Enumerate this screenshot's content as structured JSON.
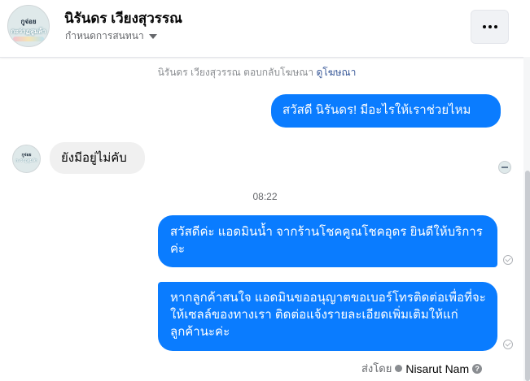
{
  "header": {
    "name": "นิรันดร เวียงสุวรรณ",
    "subtitle": "กำหนดการสนทนา",
    "avatar_text_line1": "กูจ่อย",
    "avatar_text_line2": "กะว่าฏสูมล้า"
  },
  "context": {
    "text": "นิรันดร เวียงสุวรรณ ตอบกลับโฆษณา",
    "link": "ดูโฆษณา"
  },
  "messages": [
    {
      "direction": "outgoing",
      "text": "สวัสดี นิรันดร! มีอะไรให้เราช่วยไหม"
    },
    {
      "direction": "incoming",
      "text": "ยังมีอยู่ไม่คับ"
    },
    {
      "direction": "outgoing",
      "text": "สวัสดีค่ะ แอดมินน้ำ จากร้านโชคคูณโชคอุดร ยินดีให้บริการค่ะ"
    },
    {
      "direction": "outgoing",
      "text": "หากลูกค้าสนใจ แอดมินขออนุญาตขอเบอร์โทรติดต่อเพื่อที่จะให้เซลล์ของทางเรา ติดต่อแจ้งรายละเอียดเพิ่มเติมให้แก่ลูกค้านะค่ะ"
    }
  ],
  "timestamp": "08:22",
  "footer": {
    "sent_by_label": "ส่งโดย",
    "sender": "Nisarut Nam",
    "help_glyph": "?"
  },
  "colors": {
    "outgoing_bubble": "#0a7cff",
    "incoming_bubble": "#f0f0f0",
    "link": "#385898"
  },
  "icons": {
    "more": "more-horizontal-icon",
    "dropdown": "caret-down-icon",
    "delivered": "check-circle-icon",
    "help": "question-icon"
  }
}
